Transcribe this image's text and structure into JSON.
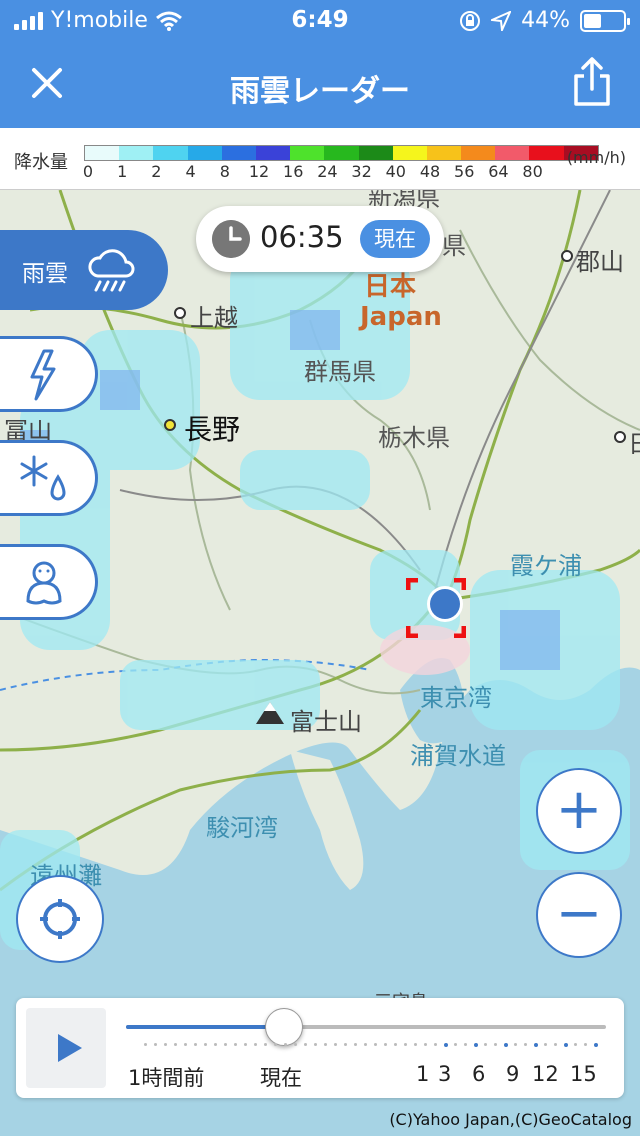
{
  "status_bar": {
    "carrier": "Y!mobile",
    "time": "6:49",
    "battery": "44%",
    "battery_level": 0.44
  },
  "header": {
    "title": "雨雲レーダー",
    "close_icon": "close-icon",
    "share_icon": "share-icon"
  },
  "legend": {
    "label": "降水量",
    "unit": "(mm/h)",
    "ticks": [
      "0",
      "1",
      "2",
      "4",
      "8",
      "12",
      "16",
      "24",
      "32",
      "40",
      "48",
      "56",
      "64",
      "80"
    ],
    "colors": [
      "#e8fbfb",
      "#9ff0f4",
      "#4fd3f0",
      "#26a9e8",
      "#2b6fe0",
      "#3a42d8",
      "#4ee22c",
      "#27b81e",
      "#1c8a18",
      "#f5f51c",
      "#f7c21a",
      "#f48a1c",
      "#f25a6a",
      "#e8101c",
      "#a80d22"
    ]
  },
  "time_pill": {
    "time": "06:35",
    "now_label": "現在"
  },
  "layers": {
    "rain": {
      "label": "雨雲",
      "icon": "rain-cloud-icon"
    },
    "lightning": {
      "icon": "lightning-icon"
    },
    "snow": {
      "icon": "snow-drop-icon"
    },
    "snowman": {
      "icon": "snowman-icon"
    }
  },
  "map": {
    "places": [
      {
        "name": "新潟県",
        "kind": "pref"
      },
      {
        "name": "島県",
        "kind": "pref"
      },
      {
        "name": "郡山",
        "kind": "city"
      },
      {
        "name": "上越",
        "kind": "city"
      },
      {
        "name": "日本",
        "kind": "country"
      },
      {
        "name": "Japan",
        "kind": "country"
      },
      {
        "name": "群馬県",
        "kind": "pref"
      },
      {
        "name": "富山",
        "kind": "city"
      },
      {
        "name": "長野",
        "kind": "capital"
      },
      {
        "name": "栃木県",
        "kind": "pref"
      },
      {
        "name": "日",
        "kind": "city"
      },
      {
        "name": "霞ケ浦",
        "kind": "water"
      },
      {
        "name": "東京湾",
        "kind": "water"
      },
      {
        "name": "富士山",
        "kind": "mountain"
      },
      {
        "name": "浦賀水道",
        "kind": "water"
      },
      {
        "name": "駿河湾",
        "kind": "water"
      },
      {
        "name": "遠州灘",
        "kind": "water"
      },
      {
        "name": "三宅島",
        "kind": "island"
      }
    ]
  },
  "controls": {
    "zoom_in": "+",
    "zoom_out": "−",
    "locate_icon": "crosshair-icon"
  },
  "timeline": {
    "progress": 0.33,
    "labels": [
      "1時間前",
      "現在",
      "1",
      "3",
      "6",
      "9",
      "12",
      "15"
    ]
  },
  "copyright": "(C)Yahoo Japan,(C)GeoCatalog"
}
